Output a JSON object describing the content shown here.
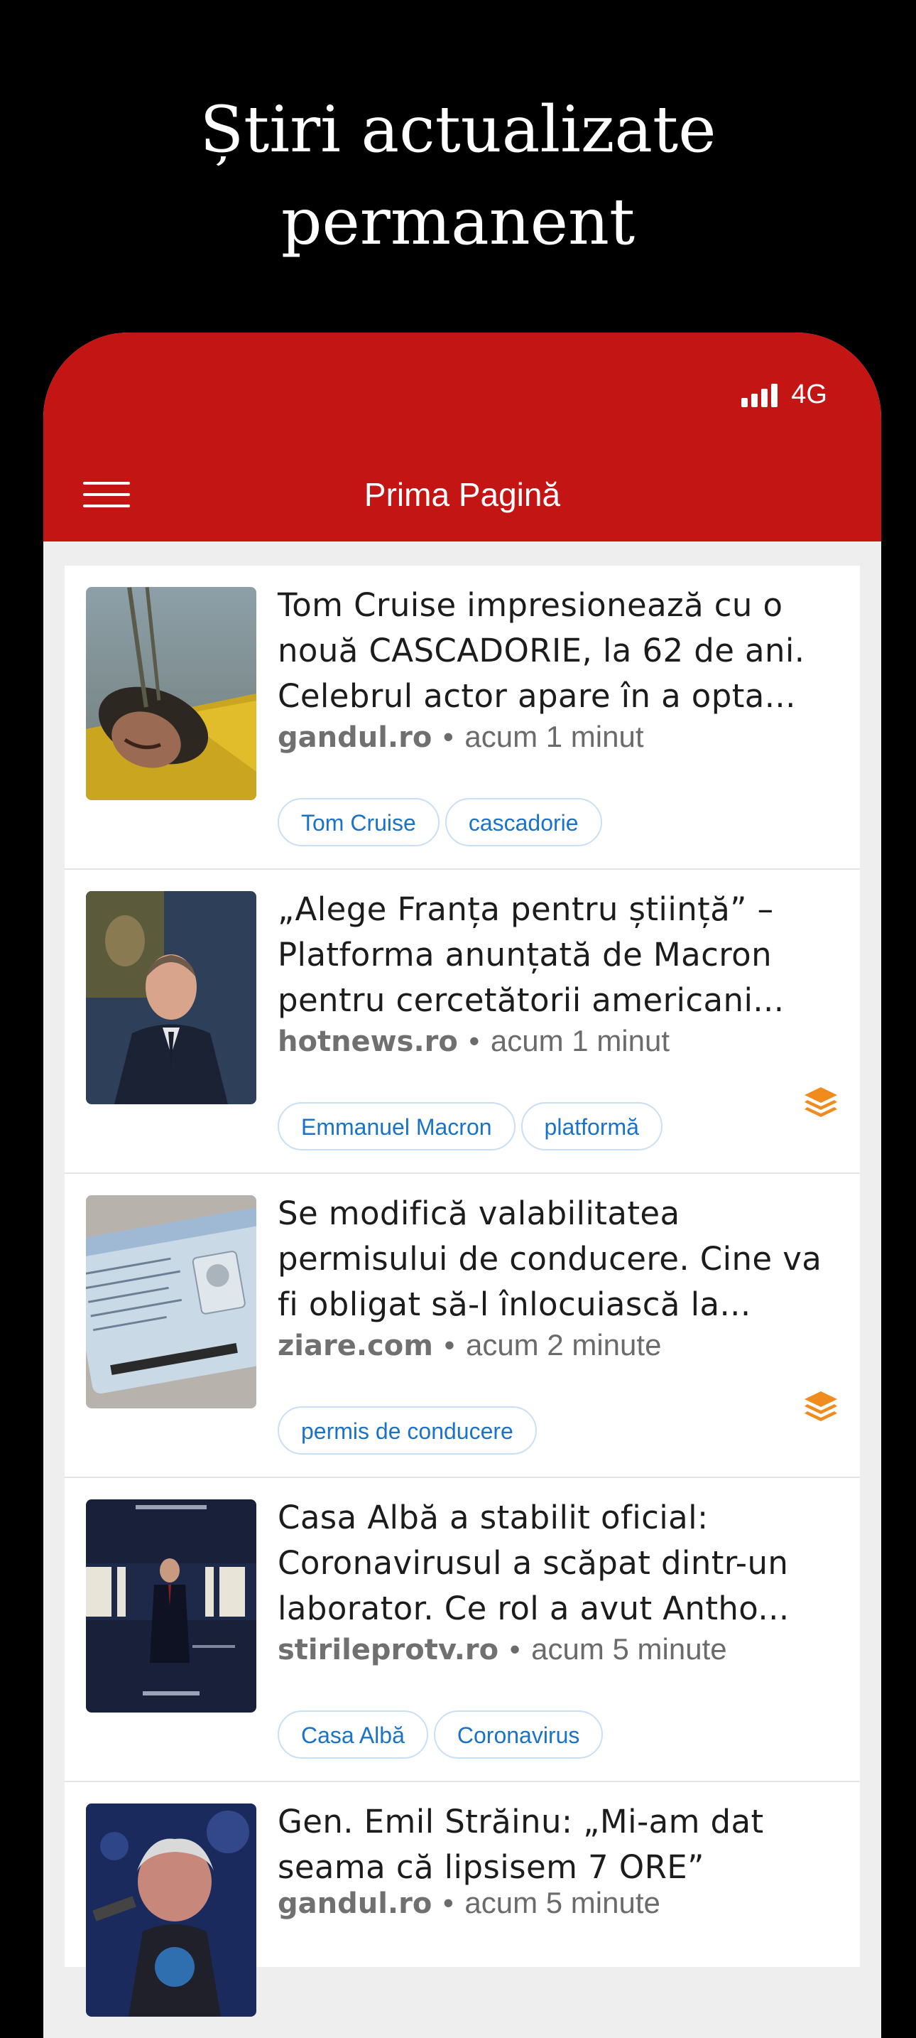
{
  "promo": {
    "title_line1": "Știri actualizate",
    "title_line2": "permanent"
  },
  "status_bar": {
    "network": "4G",
    "signal_icon": "cellular-signal-icon"
  },
  "header": {
    "title": "Prima Pagină",
    "menu_icon": "hamburger-menu-icon",
    "background": "#c41515"
  },
  "colors": {
    "tag_text": "#1a73c8",
    "tag_border": "#c9dff5",
    "layers_icon": "#f08c1e"
  },
  "articles": [
    {
      "headline": "Tom Cruise impresionează cu o nouă CASCADORIE, la 62 de ani. Celebrul actor apare în a opta...",
      "source": "gandul.ro",
      "separator": "•",
      "time": "acum 1 minut",
      "tags": [
        "Tom Cruise",
        "cascadorie"
      ],
      "has_related": false
    },
    {
      "headline": "„Alege Franța pentru știință” – Platforma anunțată de Macron pentru cercetătorii americani...",
      "source": "hotnews.ro",
      "separator": "•",
      "time": "acum 1 minut",
      "tags": [
        "Emmanuel Macron",
        "platformă"
      ],
      "has_related": true
    },
    {
      "headline": "Se modifică valabilitatea permisului de conducere. Cine va fi obligat să-l înlocuiască la...",
      "source": "ziare.com",
      "separator": "•",
      "time": "acum 2 minute",
      "tags": [
        "permis de conducere"
      ],
      "has_related": true
    },
    {
      "headline": "Casa Albă a stabilit oficial: Coronavirusul a scăpat dintr-un laborator. Ce rol a avut Antho...",
      "source": "stirileprotv.ro",
      "separator": "•",
      "time": "acum 5 minute",
      "tags": [
        "Casa Albă",
        "Coronavirus"
      ],
      "has_related": false
    },
    {
      "headline": "Gen. Emil Străinu: „Mi-am dat seama că lipsisem 7 ORE”",
      "source": "gandul.ro",
      "separator": "•",
      "time": "acum 5 minute",
      "tags": [],
      "has_related": false
    }
  ]
}
